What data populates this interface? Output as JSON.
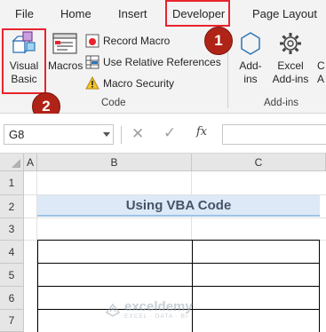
{
  "tabs": {
    "file": "File",
    "home": "Home",
    "insert": "Insert",
    "developer": "Developer",
    "page_layout": "Page Layout"
  },
  "ribbon": {
    "visual_basic_line1": "Visual",
    "visual_basic_line2": "Basic",
    "macros": "Macros",
    "record_macro": "Record Macro",
    "use_relative": "Use Relative References",
    "macro_security": "Macro Security",
    "code_group": "Code",
    "addins_line1": "Add-",
    "addins_line2": "ins",
    "excel_addins_line1": "Excel",
    "excel_addins_line2": "Add-ins",
    "addins_group": "Add-ins",
    "partial_label_c": "C",
    "partial_label_a": "A"
  },
  "badges": {
    "step1": "1",
    "step2": "2"
  },
  "formula_bar": {
    "name_box": "G8",
    "cancel_icon": "✕",
    "enter_icon": "✓",
    "function_icon": "fx"
  },
  "grid": {
    "columns": [
      "A",
      "B",
      "C"
    ],
    "rows": [
      "1",
      "2",
      "3",
      "4",
      "5",
      "6",
      "7"
    ],
    "title": "Using VBA Code"
  },
  "watermark": {
    "name": "exceldemy",
    "tagline": "EXCEL · DATA · BI"
  },
  "colors": {
    "highlight_red": "#e8242c",
    "badge_red": "#b02418",
    "title_fill": "#dde9f6",
    "title_text": "#44546a"
  }
}
